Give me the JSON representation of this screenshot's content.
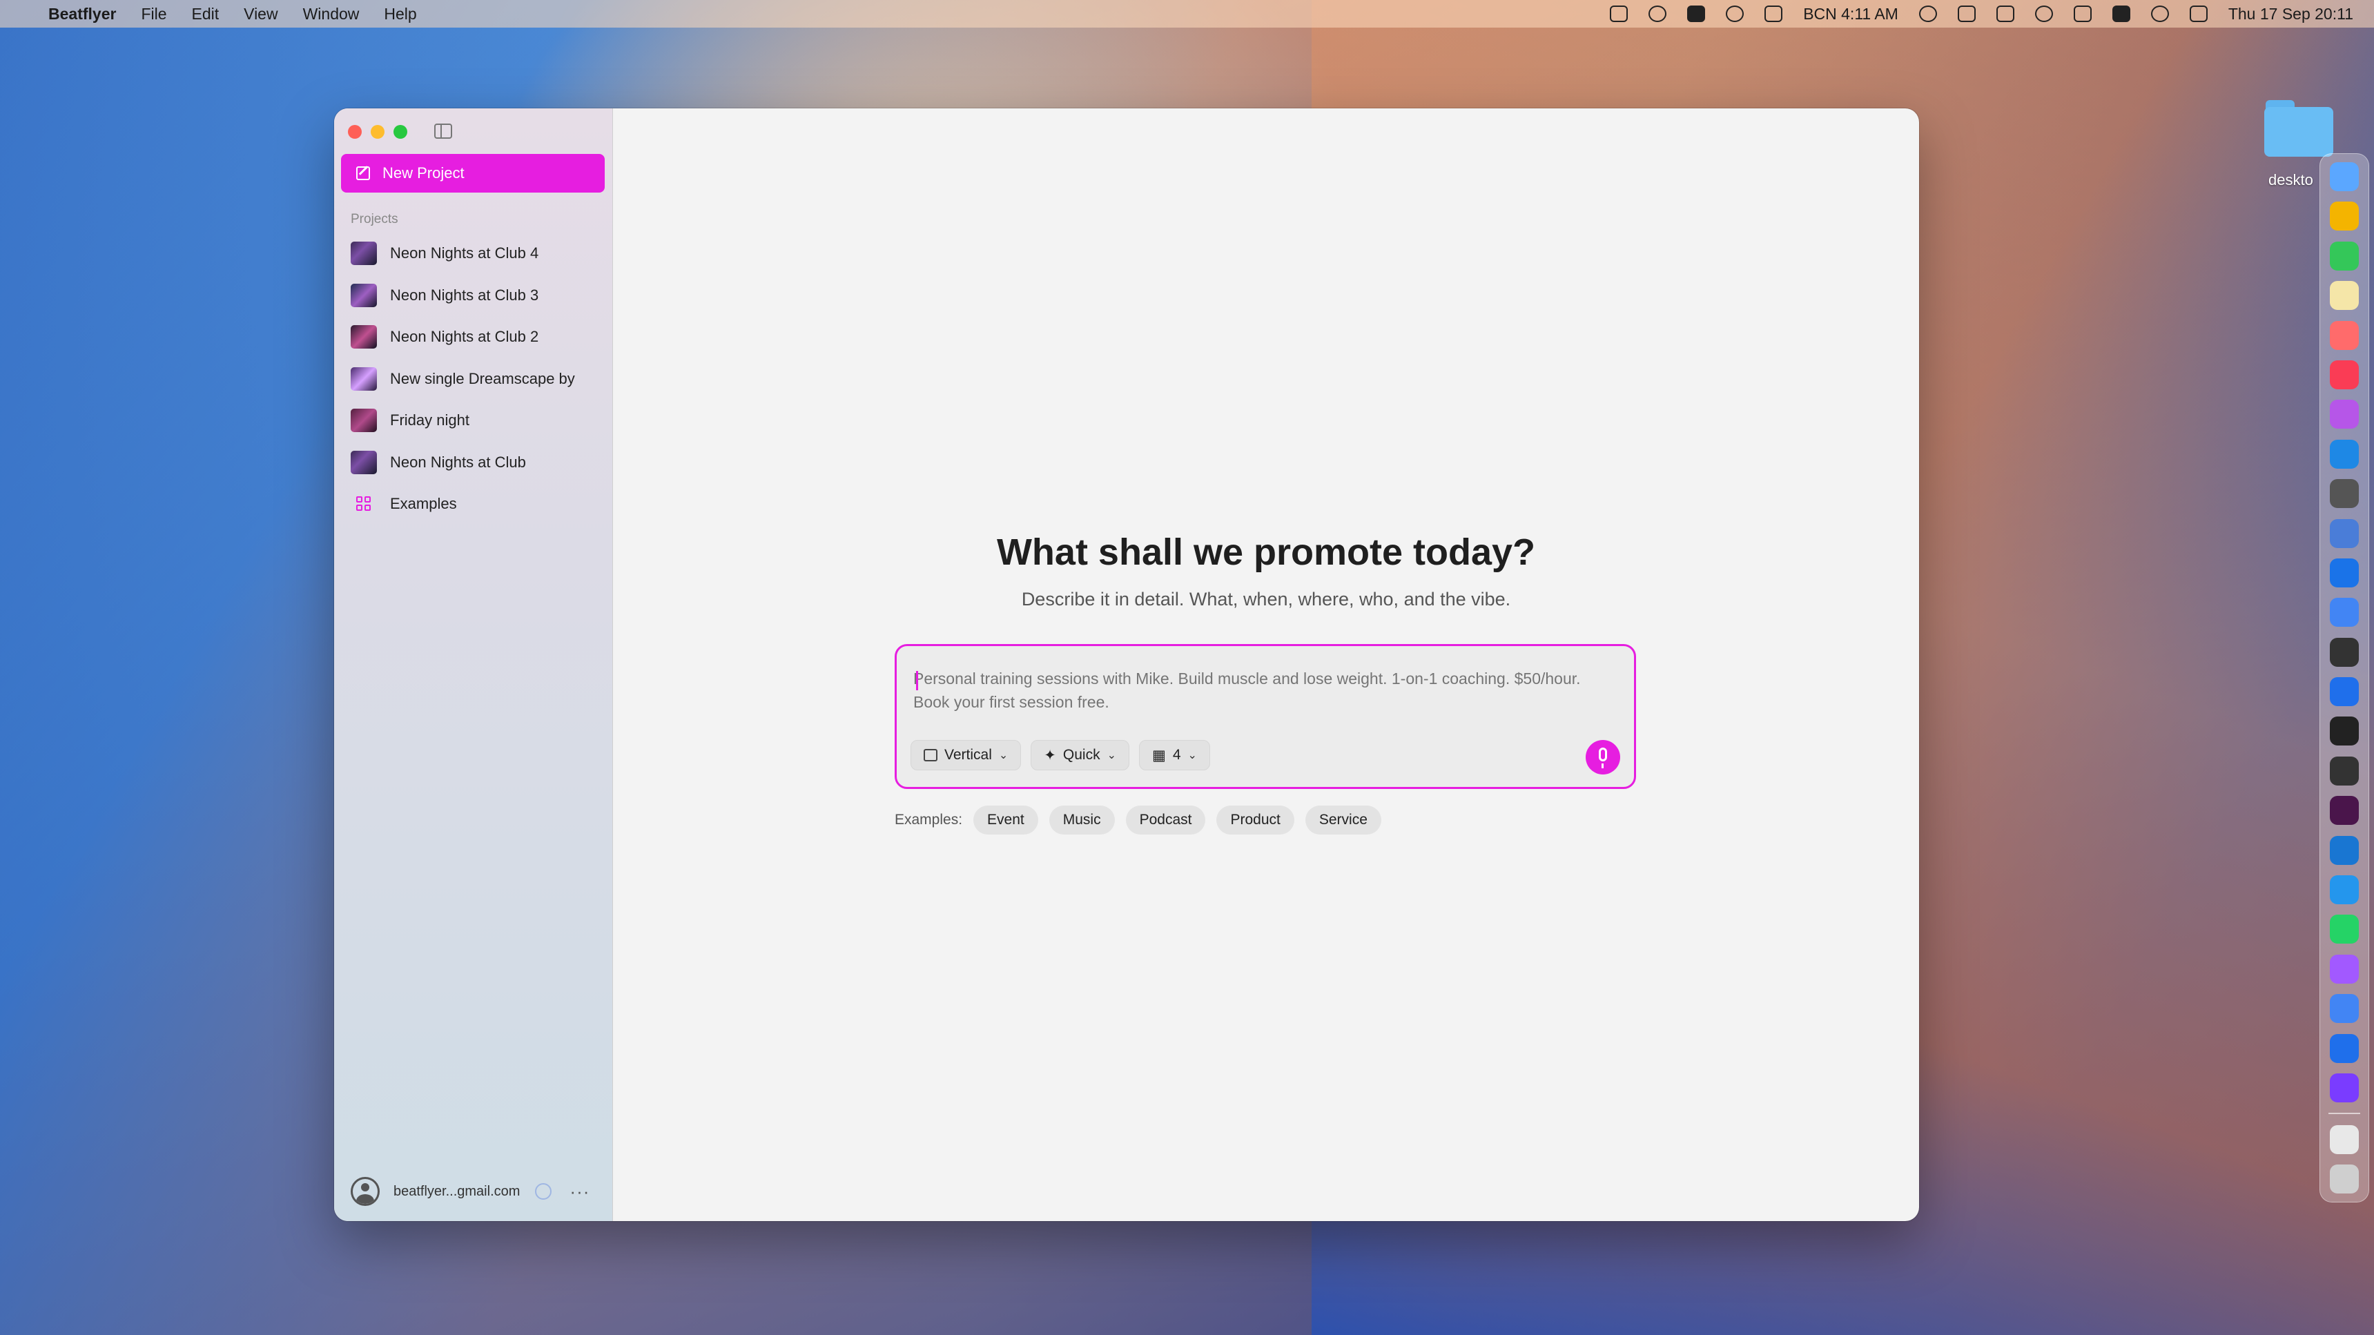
{
  "menubar": {
    "app_name": "Beatflyer",
    "menus": [
      "File",
      "Edit",
      "View",
      "Window",
      "Help"
    ],
    "status_text": "BCN 4:11 AM",
    "clock": "Thu 17 Sep  20:11"
  },
  "desktop": {
    "folder_label": "deskto"
  },
  "dock": {
    "icon_colors": [
      "#5ba7ff",
      "#f4b400",
      "#34c759",
      "#f5e6a8",
      "#ff6b6b",
      "#fa3c55",
      "#b656e8",
      "#1e88e5",
      "#555555",
      "#4a7dd8",
      "#1a73e8",
      "#4285f4",
      "#333333",
      "#1f6feb",
      "#222222",
      "#333333",
      "#4a154b",
      "#1976d2",
      "#2496ed",
      "#25d366",
      "#a259ff",
      "#4285f4",
      "#1f6feb",
      "#7a3cff"
    ],
    "extra_colors": [
      "#e8e8e8",
      "#cfcfcf"
    ]
  },
  "sidebar": {
    "new_project_label": "New Project",
    "projects_heading": "Projects",
    "projects": [
      "Neon Nights at Club 4",
      "Neon Nights at Club 3",
      "Neon Nights at Club 2",
      "New single Dreamscape by",
      "Friday night",
      "Neon Nights at Club"
    ],
    "examples_label": "Examples",
    "account_email": "beatflyer...gmail.com",
    "more_label": "···"
  },
  "main": {
    "title": "What shall we promote today?",
    "subtitle": "Describe it in detail. What, when, where, who, and the vibe.",
    "prompt_placeholder": "Personal training sessions with Mike. Build muscle and lose weight. 1-on-1 coaching. $50/hour. Book your first session free.",
    "options": {
      "orientation": "Vertical",
      "mode": "Quick",
      "count": "4"
    },
    "examples_label": "Examples:",
    "example_chips": [
      "Event",
      "Music",
      "Podcast",
      "Product",
      "Service"
    ]
  },
  "colors": {
    "accent": "#e61ee0"
  }
}
